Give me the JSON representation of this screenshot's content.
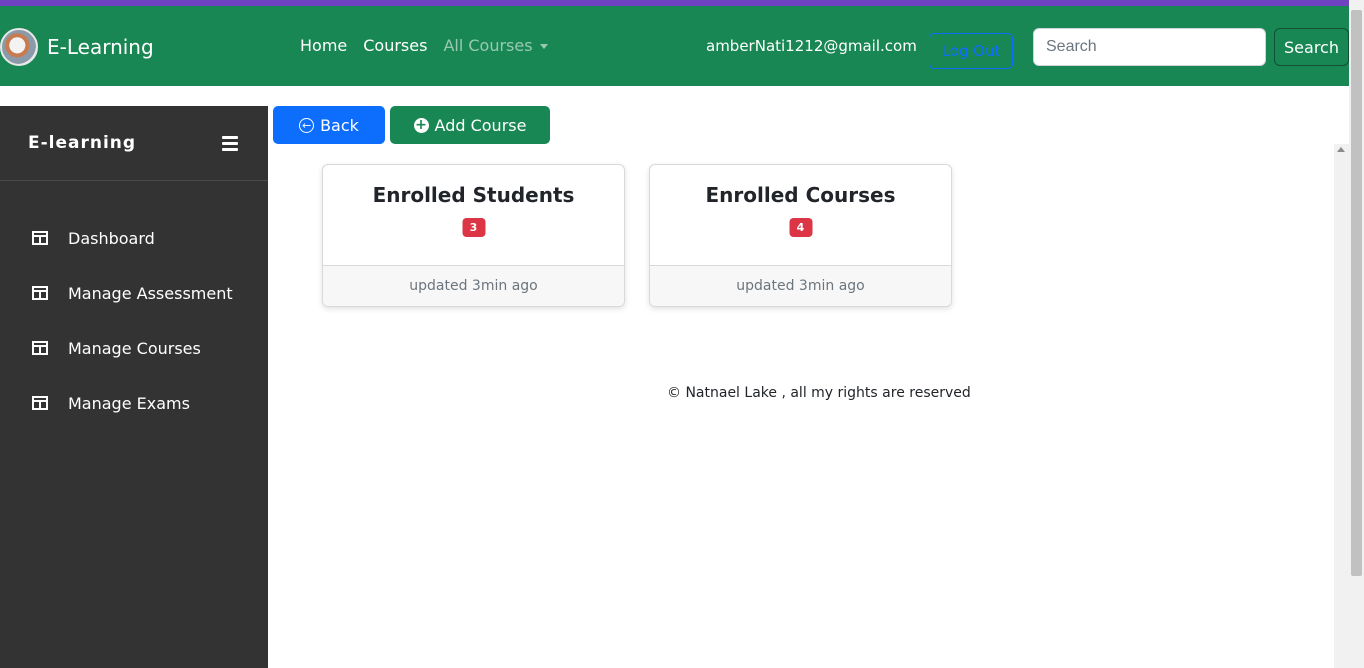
{
  "navbar": {
    "brand": "E-Learning",
    "links": [
      {
        "label": "Home"
      },
      {
        "label": "Courses"
      },
      {
        "label": "All Courses"
      }
    ],
    "user_email": "amberNati1212@gmail.com",
    "logout_label": "Log Out",
    "search_placeholder": "Search",
    "search_button": "Search"
  },
  "sidebar": {
    "title": "E-learning",
    "items": [
      {
        "label": "Dashboard",
        "icon": "table-icon"
      },
      {
        "label": "Manage Assessment",
        "icon": "table-icon"
      },
      {
        "label": "Manage Courses",
        "icon": "table-icon"
      },
      {
        "label": "Manage Exams",
        "icon": "table-icon"
      }
    ]
  },
  "actions": {
    "back_label": "Back",
    "add_course_label": "Add Course"
  },
  "cards": [
    {
      "title": "Enrolled Students",
      "count": "3",
      "footer": "updated 3min ago"
    },
    {
      "title": "Enrolled Courses",
      "count": "4",
      "footer": "updated 3min ago"
    }
  ],
  "footer": {
    "copyright": "© Natnael Lake , all my rights are reserved"
  },
  "colors": {
    "navbar": "#198754",
    "sidebar": "#333333",
    "primary": "#0d6efd",
    "badge": "#dc3545"
  }
}
